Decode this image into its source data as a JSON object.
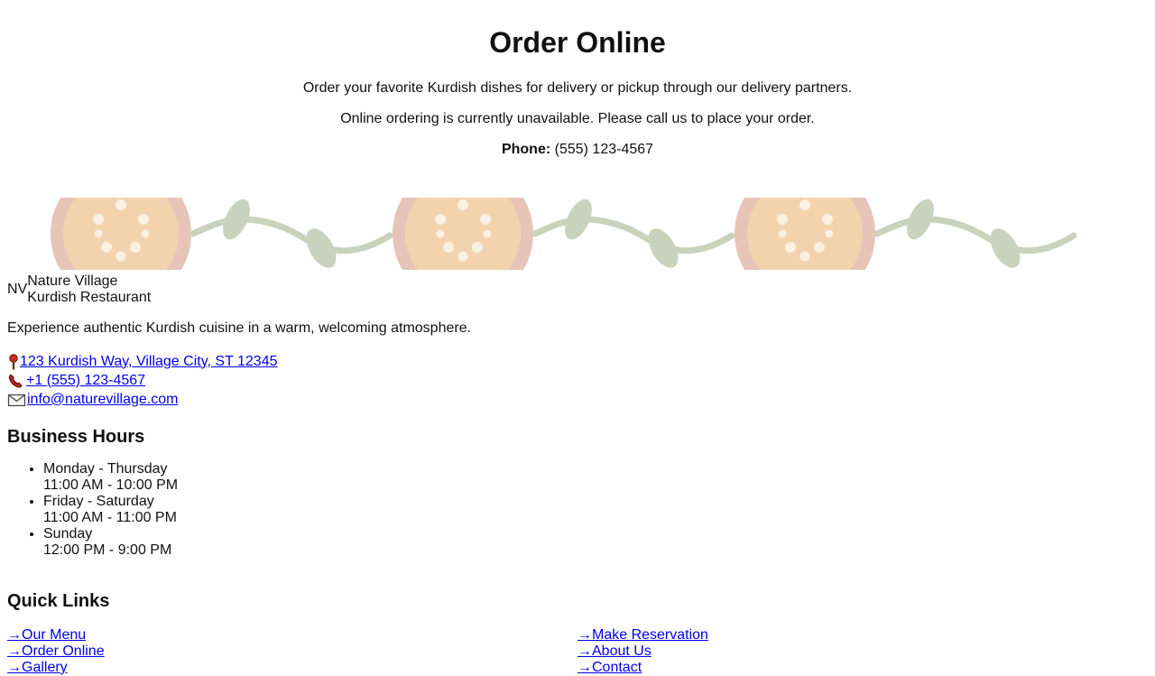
{
  "hero": {
    "title": "Order Online",
    "subtitle": "Order your favorite Kurdish dishes for delivery or pickup through our delivery partners.",
    "notice": "Online ordering is currently unavailable. Please call us to place your order.",
    "phone_label": "Phone:",
    "phone_value": "(555) 123-4567"
  },
  "decor": {
    "icon": "floral-vine-divider",
    "colors": {
      "circle_outer": "#e6c4b8",
      "circle_inner": "#f2d3ae",
      "dots": "#fbf1e3",
      "vine": "#c8d2bd"
    }
  },
  "footer": {
    "brand_mark": "NV",
    "brand_name": "Nature Village",
    "brand_sub": "Kurdish Restaurant",
    "tagline": "Experience authentic Kurdish cuisine in a warm, welcoming atmosphere.",
    "address": "123 Kurdish Way, Village City, ST 12345",
    "phone": "+1 (555) 123-4567",
    "email": "info@naturevillage.com",
    "hours_title": "Business Hours",
    "hours": [
      {
        "days": "Monday - Thursday",
        "time": "11:00 AM - 10:00 PM"
      },
      {
        "days": "Friday - Saturday",
        "time": "11:00 AM - 11:00 PM"
      },
      {
        "days": "Sunday",
        "time": "12:00 PM - 9:00 PM"
      }
    ],
    "quick_links_title": "Quick Links",
    "arrow": "→",
    "quick_links": [
      "Our Menu",
      "Order Online",
      "Gallery",
      "Make Reservation",
      "About Us",
      "Contact"
    ]
  }
}
